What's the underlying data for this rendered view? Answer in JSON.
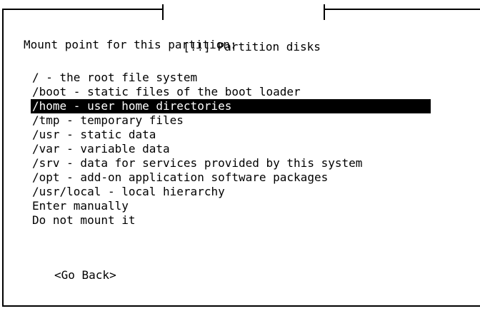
{
  "dialog": {
    "title": "[!!] Partition disks",
    "prompt": "Mount point for this partition:",
    "selected_index": 2,
    "options": [
      "/ - the root file system",
      "/boot - static files of the boot loader",
      "/home - user home directories",
      "/tmp - temporary files",
      "/usr - static data",
      "/var - variable data",
      "/srv - data for services provided by this system",
      "/opt - add-on application software packages",
      "/usr/local - local hierarchy",
      "Enter manually",
      "Do not mount it"
    ],
    "go_back_label": "<Go Back>"
  },
  "colors": {
    "background": "#ffffff",
    "foreground": "#000000",
    "highlight_bg": "#000000",
    "highlight_fg": "#ffffff"
  }
}
